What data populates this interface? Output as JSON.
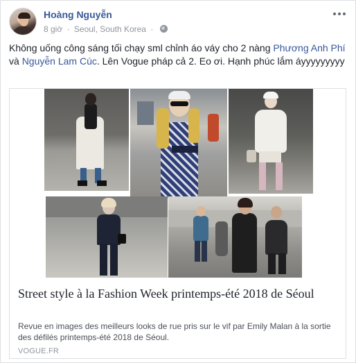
{
  "post": {
    "author": "Hoàng Nguyễn",
    "time": "8 giờ",
    "location": "Seoul, South Korea",
    "privacy_icon": "globe-icon",
    "menu_icon": "more-options-icon",
    "text_part1": "Không uống công sáng tối chạy sml chỉnh áo váy cho 2 nàng ",
    "tag1": "Phương Anh Phí",
    "text_and": " và ",
    "tag2": "Nguyễn Lam Cúc",
    "text_part2": ". Lên Vogue pháp cả 2. Eo ơi. Hạnh phúc lắm áyyyyyyyyy"
  },
  "link_card": {
    "title": "Street style à la Fashion Week printemps-été 2018 de Séoul",
    "description": "Revue en images des meilleurs looks de rue pris sur le vif par Emily Malan à la sortie des défilés printemps-été 2018 de Séoul.",
    "domain": "VOGUE.FR"
  },
  "colors": {
    "author_link": "#385898",
    "tag_link": "#365899",
    "meta_text": "#90949c"
  }
}
